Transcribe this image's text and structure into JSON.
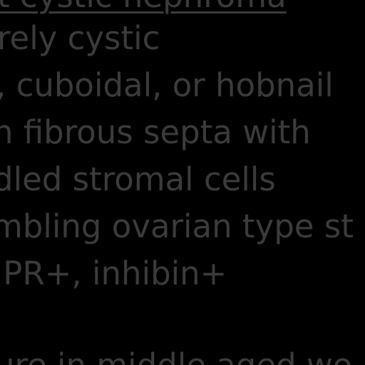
{
  "document": {
    "lines": [
      "t cystic nephroma",
      "rely cystic",
      ", cuboidal, or hobnail",
      "n fibrous septa with",
      "dled stromal cells",
      "mbling ovarian type st",
      ",PR+, inhibin+",
      "ure in middle aged wo"
    ]
  },
  "colors": {
    "background": "#000000",
    "text": "#3b3b3b"
  }
}
